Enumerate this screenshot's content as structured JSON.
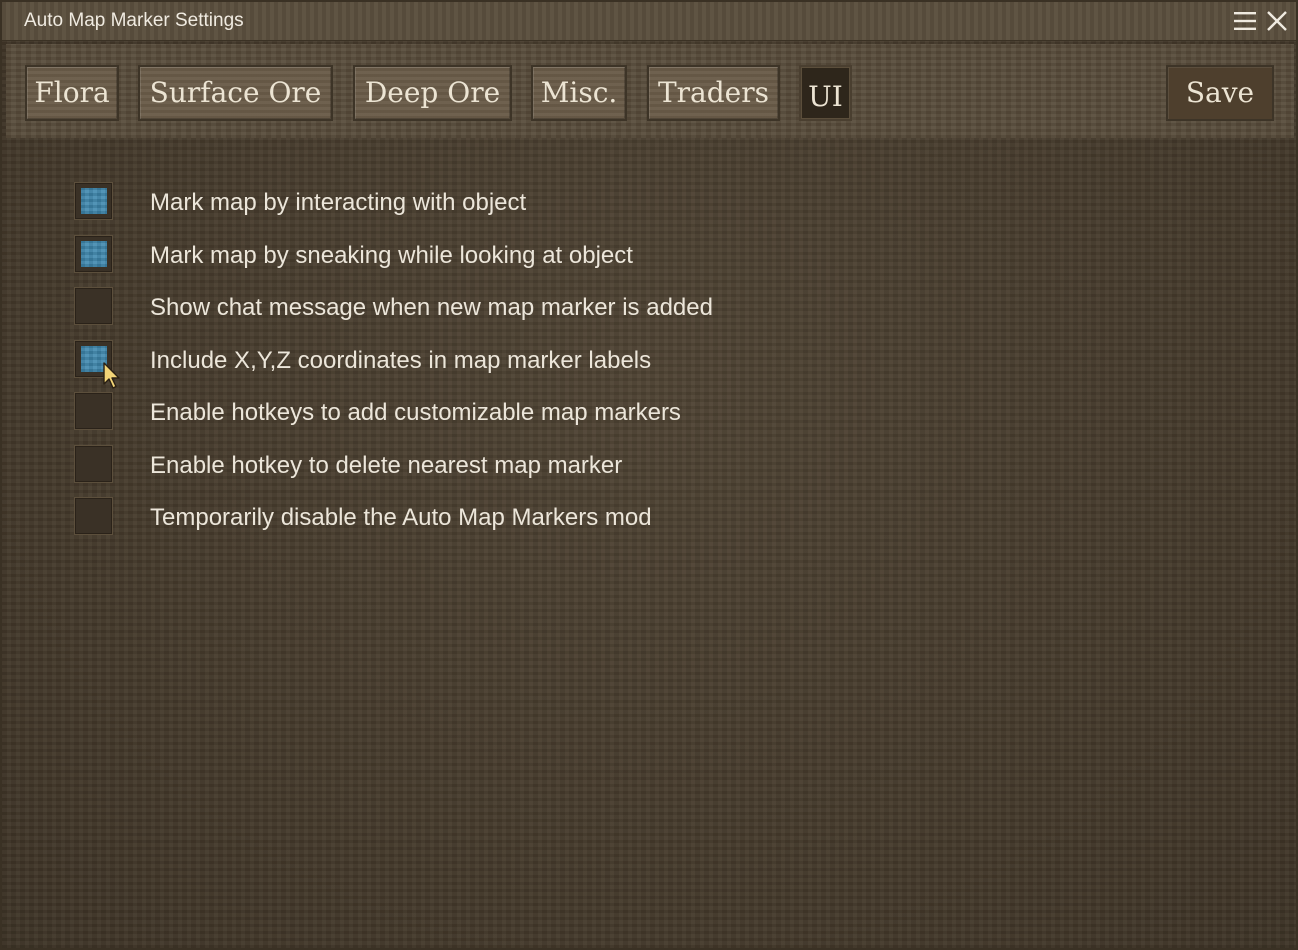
{
  "window": {
    "title": "Auto Map Marker Settings"
  },
  "tabs": [
    {
      "label": "Flora",
      "active": false
    },
    {
      "label": "Surface Ore",
      "active": false
    },
    {
      "label": "Deep Ore",
      "active": false
    },
    {
      "label": "Misc.",
      "active": false
    },
    {
      "label": "Traders",
      "active": false
    },
    {
      "label": "UI",
      "active": true
    }
  ],
  "save_label": "Save",
  "options": [
    {
      "label": "Mark map by interacting with object",
      "checked": true
    },
    {
      "label": "Mark map by sneaking while looking at object",
      "checked": true
    },
    {
      "label": "Show chat message when new map marker is added",
      "checked": false
    },
    {
      "label": "Include X,Y,Z coordinates in map marker labels",
      "checked": true
    },
    {
      "label": "Enable hotkeys to add customizable map markers",
      "checked": false
    },
    {
      "label": "Enable hotkey to delete nearest map marker",
      "checked": false
    },
    {
      "label": "Temporarily disable the Auto Map Markers mod",
      "checked": false
    }
  ],
  "icons": {
    "menu": "hamburger-menu-icon",
    "close": "close-icon",
    "pointer": "mouse-pointer-icon"
  },
  "colors": {
    "checkbox_fill": "#3e87ad",
    "text": "#ece6da",
    "active_tab": "#2e261b"
  }
}
